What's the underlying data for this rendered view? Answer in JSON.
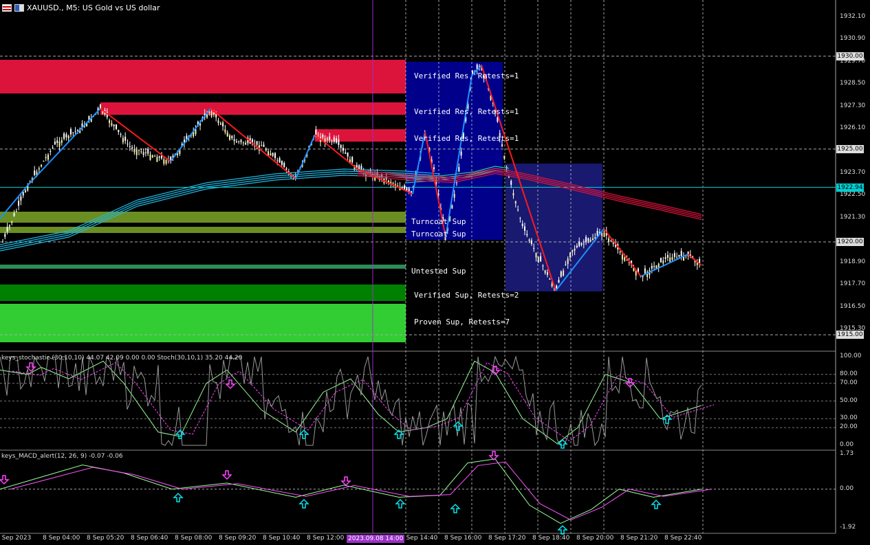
{
  "window": {
    "title": "XAUUSD., M5:  US Gold vs US dollar",
    "icons": [
      "flag-icon",
      "chart-type-icon"
    ]
  },
  "colors": {
    "bull_candle": "#f5f0a0",
    "bear_candle": "#ffffff",
    "resistance_zone": "#dc143c",
    "support_zone_olive": "#6b8e23",
    "support_zone_green": "#008000",
    "support_zone_lime": "#32cd32",
    "zigzag_up": "#1e90ff",
    "zigzag_down": "#ff1a1a",
    "ma_blue": "#1ebae6",
    "ma_red": "#dc143c",
    "stoch_main": "#9aff9a",
    "stoch_signal": "#ff44ff",
    "macd_main": "#9aff9a",
    "macd_signal": "#ff55ff",
    "arrow_up": "#00e5ee",
    "arrow_down": "#ff44ff",
    "blue_box": "#00008b",
    "navy_box": "#191970",
    "current_price": "#00ced1"
  },
  "zones": [
    {
      "label": "Verified Res, Retests=1"
    },
    {
      "label": "Verified Res, Retests=1"
    },
    {
      "label": "Verified Res, Retests=1"
    },
    {
      "label": "Turncoat Sup"
    },
    {
      "label": "Turncoat Sup"
    },
    {
      "label": "Untested Sup"
    },
    {
      "label": "Verified Sup, Retests=2"
    },
    {
      "label": "Proven Sup, Retests=7"
    }
  ],
  "price_axis": [
    "1932.10",
    "1930.90",
    "1929.70",
    "1928.50",
    "1927.30",
    "1926.10",
    "1923.70",
    "1922.50",
    "1921.30",
    "1918.90",
    "1917.70",
    "1916.50",
    "1915.30"
  ],
  "price_tags": [
    {
      "text": "1930.00",
      "kind": "level"
    },
    {
      "text": "1925.00",
      "kind": "level"
    },
    {
      "text": "1922.94",
      "kind": "current"
    },
    {
      "text": "1920.00",
      "kind": "level"
    },
    {
      "text": "1915.00",
      "kind": "level"
    }
  ],
  "time_axis": [
    "8 Sep 2023",
    "8 Sep 04:00",
    "8 Sep 05:20",
    "8 Sep 06:40",
    "8 Sep 08:00",
    "8 Sep 09:20",
    "8 Sep 10:40",
    "8 Sep 12:00",
    "8 Sep 14:40",
    "8 Sep 16:00",
    "8 Sep 17:20",
    "8 Sep 18:40",
    "8 Sep 20:00",
    "8 Sep 21:20",
    "8 Sep 22:40"
  ],
  "time_cursor": "2023.09.08 14:00",
  "stochastic": {
    "title": "keys_stochastic (30,10,10) 44.07 42.09 0.00 0.00 Stoch(30,10,1) 35.20 44.20",
    "axis": [
      "100.00",
      "80.00",
      "70.00",
      "50.00",
      "30.00",
      "20.00",
      "0.00"
    ]
  },
  "macd": {
    "title": "keys_MACD_alert(12, 26, 9) -0.07 -0.06",
    "axis": [
      "1.73",
      "0.00",
      "-1.92"
    ]
  }
}
